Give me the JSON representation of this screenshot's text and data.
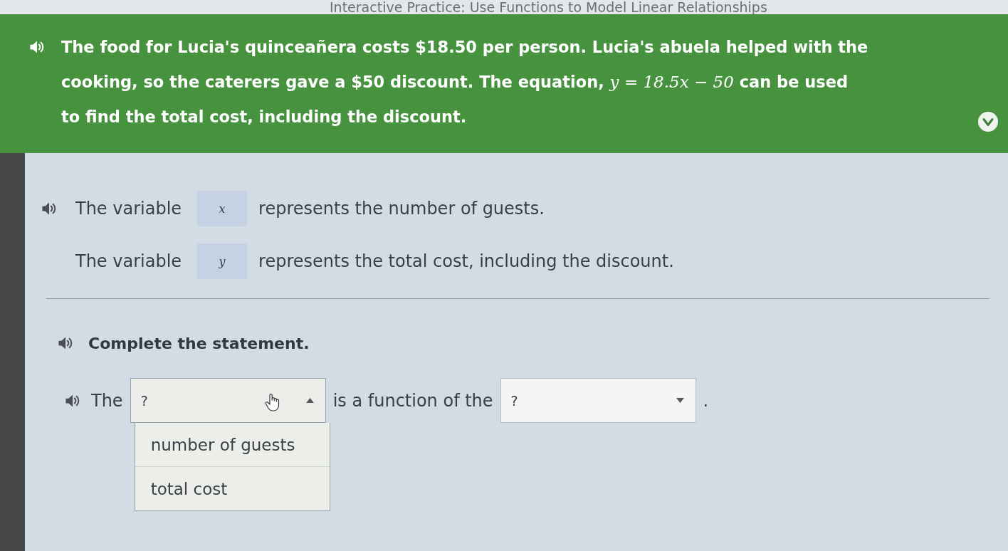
{
  "window": {
    "title": "Interactive Practice: Use Functions to Model Linear Relationships"
  },
  "prompt": {
    "audio": true,
    "lines": [
      "The food for Lucia's quinceañera costs $18.50 per person. Lucia's abuela helped with the",
      "cooking, so the caterers gave a $50 discount. The equation, *y = 18.5x − 50* can be used",
      "to find the total cost, including the discount."
    ]
  },
  "variables": [
    {
      "audio": true,
      "lead": "The variable",
      "symbol": "x",
      "description": "represents the number of guests."
    },
    {
      "audio": false,
      "lead": "The variable",
      "symbol": "y",
      "description": "represents the total cost, including the discount."
    }
  ],
  "task": {
    "audio": true,
    "heading": "Complete the statement."
  },
  "statement": {
    "audio": true,
    "parts": [
      {
        "kind": "text",
        "text": "The"
      },
      {
        "kind": "dropdown",
        "value": "?",
        "expanded": true,
        "options": [
          {
            "label": "number of guests",
            "selected": false
          },
          {
            "label": "total cost",
            "selected": false
          }
        ]
      },
      {
        "kind": "text",
        "text": "is a function of the"
      },
      {
        "kind": "dropdown",
        "value": "?",
        "expanded": false
      },
      {
        "kind": "text",
        "text": "."
      }
    ]
  }
}
